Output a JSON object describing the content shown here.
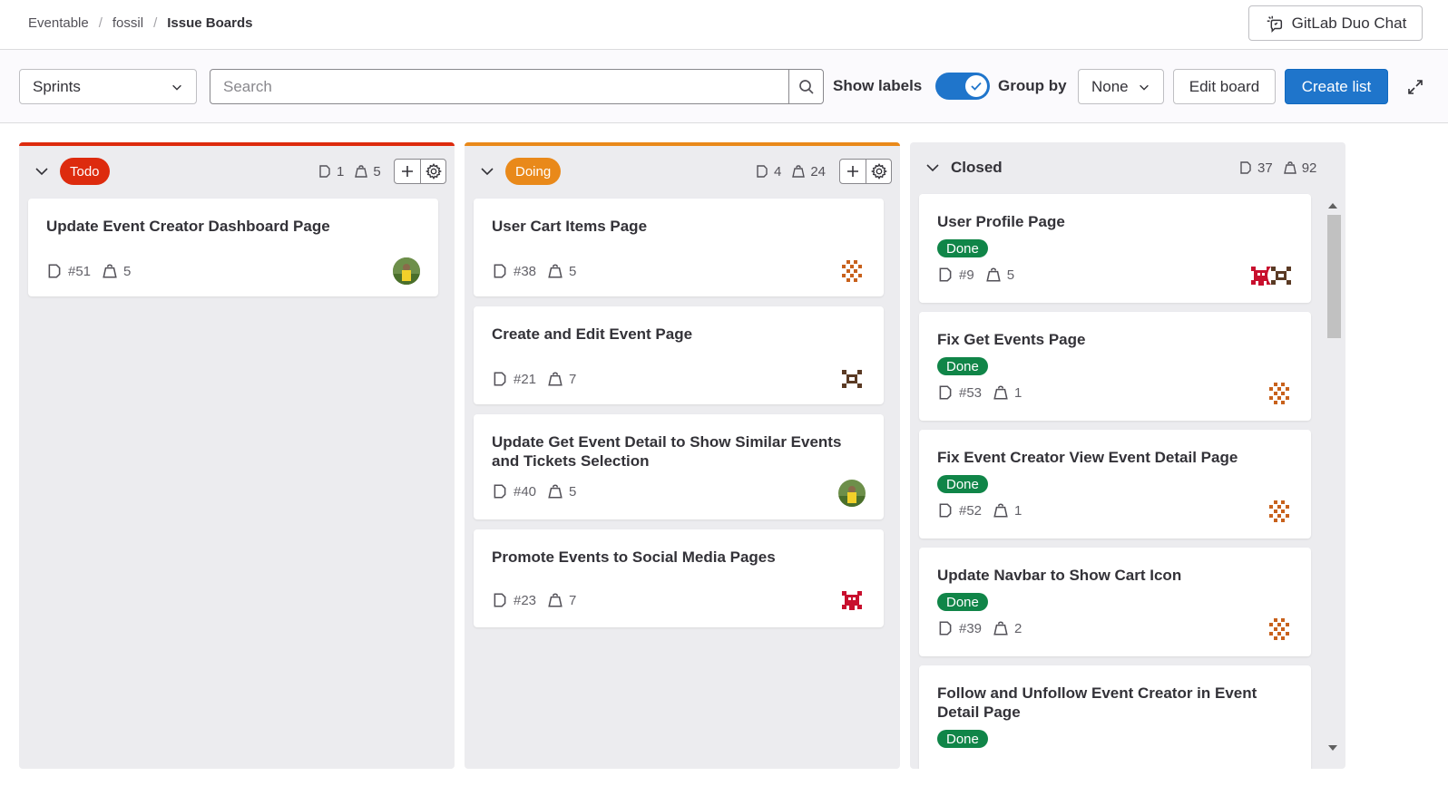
{
  "breadcrumb": {
    "items": [
      "Eventable",
      "fossil"
    ],
    "current": "Issue Boards",
    "separator": "/"
  },
  "duo_chat": {
    "label": "GitLab Duo Chat",
    "icon": "duo-chat-icon"
  },
  "filters": {
    "sprints_select": "Sprints",
    "search_placeholder": "Search",
    "show_labels_label": "Show labels",
    "show_labels_on": true,
    "group_by_label": "Group by",
    "group_by_value": "None",
    "edit_board": "Edit board",
    "create_list": "Create list"
  },
  "colors": {
    "todo": "#dd2b0e",
    "doing": "#e9891a",
    "done": "#108548",
    "primary": "#1f75cb"
  },
  "boards": [
    {
      "name": "Todo",
      "issues_count": "1",
      "weight_count": "5",
      "cards": [
        {
          "title": "Update Event Creator Dashboard Page",
          "number": "#51",
          "weight": "5",
          "avatar": "photo-avatar"
        }
      ]
    },
    {
      "name": "Doing",
      "issues_count": "4",
      "weight_count": "24",
      "cards": [
        {
          "title": "User Cart Items Page",
          "number": "#38",
          "weight": "5",
          "avatar": "pattern-orange-avatar"
        },
        {
          "title": "Create and Edit Event Page",
          "number": "#21",
          "weight": "7",
          "avatar": "pattern-brown-avatar"
        },
        {
          "title": "Update Get Event Detail to Show Similar Events and Tickets Selection",
          "number": "#40",
          "weight": "5",
          "avatar": "photo-avatar"
        },
        {
          "title": "Promote Events to Social Media Pages",
          "number": "#23",
          "weight": "7",
          "avatar": "pattern-red-avatar"
        }
      ]
    },
    {
      "name": "Closed",
      "issues_count": "37",
      "weight_count": "92",
      "cards": [
        {
          "title": "User Profile Page",
          "label": "Done",
          "number": "#9",
          "weight": "5",
          "avatar": "pattern-red-avatar"
        },
        {
          "title": "Fix Get Events Page",
          "label": "Done",
          "number": "#53",
          "weight": "1",
          "avatar": "pattern-orange-avatar"
        },
        {
          "title": "Fix Event Creator View Event Detail Page",
          "label": "Done",
          "number": "#52",
          "weight": "1",
          "avatar": "pattern-orange-avatar"
        },
        {
          "title": "Update Navbar to Show Cart Icon",
          "label": "Done",
          "number": "#39",
          "weight": "2",
          "avatar": "pattern-orange-avatar"
        },
        {
          "title": "Follow and Unfollow Event Creator in Event Detail Page",
          "label": "Done"
        }
      ]
    }
  ]
}
